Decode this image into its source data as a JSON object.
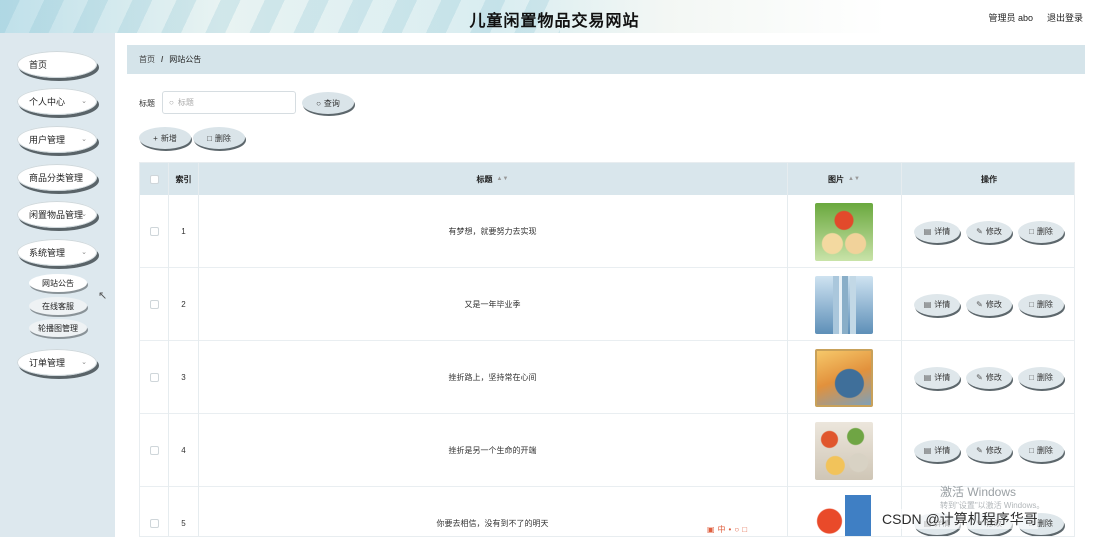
{
  "header": {
    "title": "儿童闲置物品交易网站",
    "user": "管理员 abo",
    "logout": "退出登录"
  },
  "sidebar": {
    "items": [
      {
        "label": "首页",
        "has_arrow": false
      },
      {
        "label": "个人中心",
        "has_arrow": true
      },
      {
        "label": "用户管理",
        "has_arrow": true
      },
      {
        "label": "商品分类管理",
        "has_arrow": false
      },
      {
        "label": "闲置物品管理",
        "has_arrow": true
      },
      {
        "label": "系统管理",
        "has_arrow": true
      },
      {
        "label": "订单管理",
        "has_arrow": true
      }
    ],
    "sub_items": [
      {
        "label": "网站公告",
        "active": true
      },
      {
        "label": "在线客服",
        "active": false
      },
      {
        "label": "轮播图管理",
        "active": false
      }
    ]
  },
  "breadcrumb": {
    "home": "首页",
    "separator": "/",
    "current": "网站公告"
  },
  "search": {
    "label": "标题",
    "placeholder": "标题",
    "button": "查询"
  },
  "actions": {
    "add": "新增",
    "delete": "删除"
  },
  "table": {
    "columns": [
      "索引",
      "标题",
      "图片",
      "操作"
    ],
    "rows": [
      {
        "index": "1",
        "title": "有梦想，就要努力去实现"
      },
      {
        "index": "2",
        "title": "又是一年毕业季"
      },
      {
        "index": "3",
        "title": "挫折路上，坚持常在心间"
      },
      {
        "index": "4",
        "title": "挫折是另一个生命的开端"
      },
      {
        "index": "5",
        "title": "你要去相信，没有到不了的明天"
      }
    ],
    "row_actions": {
      "detail": "详情",
      "edit": "修改",
      "delete": "删除"
    }
  },
  "overlay": {
    "activate_title": "激活 Windows",
    "activate_sub": "转到\"设置\"以激活 Windows。",
    "csdn": "CSDN @计算机程序华哥"
  },
  "colors": {
    "sidebar_bg": "#dde8ee",
    "table_header_bg": "#d9e6ec",
    "button_bg": "#dae4e9"
  }
}
